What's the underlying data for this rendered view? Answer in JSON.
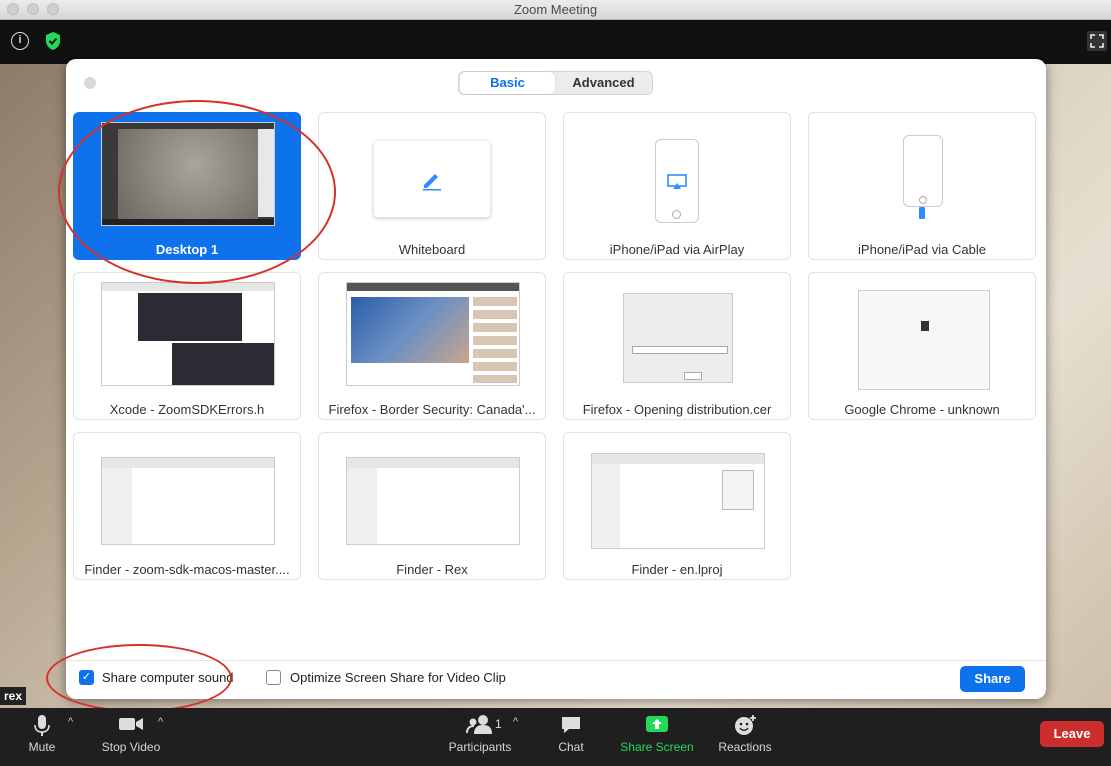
{
  "window": {
    "title": "Zoom Meeting"
  },
  "participant_name": "rex",
  "dialog": {
    "tabs": [
      {
        "label": "Basic",
        "active": true
      },
      {
        "label": "Advanced",
        "active": false
      }
    ],
    "tiles": [
      {
        "label": "Desktop 1",
        "selected": true,
        "kind": "desktop"
      },
      {
        "label": "Whiteboard",
        "selected": false,
        "kind": "whiteboard"
      },
      {
        "label": "iPhone/iPad via AirPlay",
        "selected": false,
        "kind": "airplay"
      },
      {
        "label": "iPhone/iPad via Cable",
        "selected": false,
        "kind": "cable"
      },
      {
        "label": "Xcode - ZoomSDKErrors.h",
        "selected": false,
        "kind": "window-dark"
      },
      {
        "label": "Firefox - Border Security: Canada'...",
        "selected": false,
        "kind": "window-video"
      },
      {
        "label": "Firefox - Opening distribution.cer",
        "selected": false,
        "kind": "window-dialog"
      },
      {
        "label": "Google Chrome - unknown",
        "selected": false,
        "kind": "window-blank"
      },
      {
        "label": "Finder - zoom-sdk-macos-master....",
        "selected": false,
        "kind": "window-finder"
      },
      {
        "label": "Finder - Rex",
        "selected": false,
        "kind": "window-finder"
      },
      {
        "label": "Finder - en.lproj",
        "selected": false,
        "kind": "window-finder"
      }
    ],
    "share_sound": {
      "label": "Share computer sound",
      "checked": true
    },
    "optimize_video": {
      "label": "Optimize Screen Share for Video Clip",
      "checked": false
    },
    "share_button": "Share"
  },
  "toolbar": {
    "mute": "Mute",
    "stop_video": "Stop Video",
    "participants": "Participants",
    "participants_count": "1",
    "chat": "Chat",
    "share_screen": "Share Screen",
    "reactions": "Reactions",
    "leave": "Leave"
  },
  "colors": {
    "accent": "#0e72ed",
    "leave": "#cc2d2d",
    "share_screen": "#23d959",
    "annotation": "#d6312b"
  }
}
